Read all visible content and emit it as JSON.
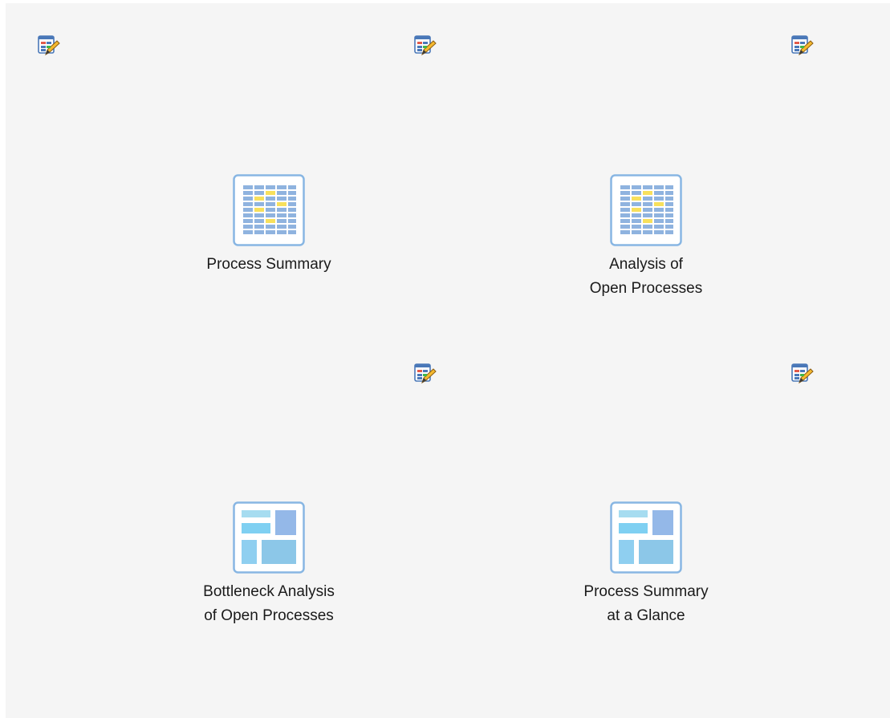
{
  "tiles": [
    {
      "label": "Process Summary",
      "icon": "table-report-icon",
      "edit_icon": "edit-report-icon"
    },
    {
      "label": "Analysis of\nOpen Processes",
      "icon": "table-report-icon",
      "edit_icon": "edit-report-icon"
    },
    {
      "label": "Bottleneck Analysis\nof Open Processes",
      "icon": "dashboard-layout-icon",
      "edit_icon": "edit-report-icon"
    },
    {
      "label": "Process Summary\nat a Glance",
      "icon": "dashboard-layout-icon",
      "edit_icon": "edit-report-icon"
    }
  ],
  "extra_edit_icon": "edit-report-icon",
  "colors": {
    "background": "#f5f5f5",
    "frame": "#88b6e3",
    "table_cell": "#8fb3df",
    "table_highlight": "#f7e05c",
    "dash_light": "#a6dcf0",
    "dash_mid": "#7fd0f2",
    "dash_dark": "#94b8e8"
  }
}
